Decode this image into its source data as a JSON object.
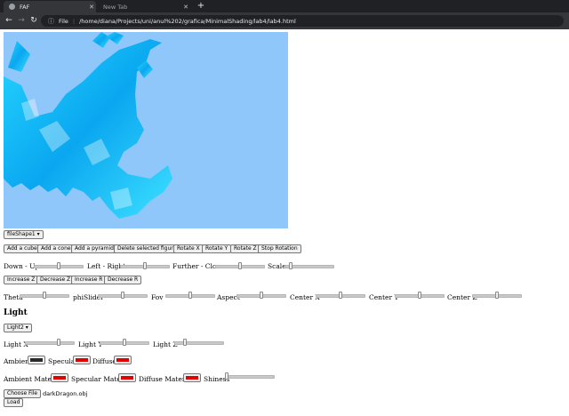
{
  "browser": {
    "tabs": [
      {
        "label": "FAF",
        "active": true
      },
      {
        "label": "New Tab",
        "active": false
      }
    ],
    "new_tab": "+",
    "nav": {
      "back": "←",
      "forward": "→",
      "reload": "↻"
    },
    "address": {
      "info_icon": "ⓘ",
      "scheme": "File",
      "separator": "|",
      "url": "/home/diana/Projects/uni/anul%202/grafica/MinimalShading/lab4/lab4.html"
    }
  },
  "scene": {
    "background": "#8fc7fb",
    "model_color": "#1ec8f5"
  },
  "shape_select": {
    "value": "fileShape1"
  },
  "shape_buttons": [
    "Add a cube",
    "Add a cone",
    "Add a pyramid",
    "Delete selected figure",
    "Rotate X",
    "Rotate Y",
    "Rotate Z",
    "Stop Rotation"
  ],
  "transform_sliders": [
    {
      "label": "Down - Up",
      "value": 0.5
    },
    {
      "label": "Left - Right",
      "value": 0.5
    },
    {
      "label": "Further - Closer",
      "value": 0.5
    },
    {
      "label": "Scale",
      "value": 0.1
    }
  ],
  "zr_buttons": [
    "Increase Z",
    "Decrease Z",
    "Increase R",
    "Decrease R"
  ],
  "camera_sliders": [
    {
      "label": "Theta",
      "value": 0.5
    },
    {
      "label": "phiSlider",
      "value": 0.5
    },
    {
      "label": "Fov",
      "value": 0.5
    },
    {
      "label": "Aspect",
      "value": 0.5
    },
    {
      "label": "Center X",
      "value": 0.5
    },
    {
      "label": "Center Y",
      "value": 0.5
    },
    {
      "label": "Center Z",
      "value": 0.5
    }
  ],
  "light": {
    "heading": "Light",
    "select_value": "Light2",
    "sliders": [
      {
        "label": "Light X",
        "value": 0.7
      },
      {
        "label": "Light Y",
        "value": 0.5
      },
      {
        "label": "Light Z",
        "value": 0.2
      }
    ],
    "colors": [
      {
        "label": "Ambient",
        "color": "#2a2a2a"
      },
      {
        "label": "Specular",
        "color": "#e00000"
      },
      {
        "label": "Diffuse",
        "color": "#e00000"
      }
    ],
    "materials": [
      {
        "label": "Ambient Material",
        "color": "#e00000"
      },
      {
        "label": "Specular Material",
        "color": "#e00000"
      },
      {
        "label": "Diffuse Material",
        "color": "#e00000"
      }
    ],
    "shiness": {
      "label": "Shiness",
      "value": 0.0
    }
  },
  "file": {
    "button": "Choose File",
    "filename": "darkDragon.obj",
    "load": "Load"
  }
}
